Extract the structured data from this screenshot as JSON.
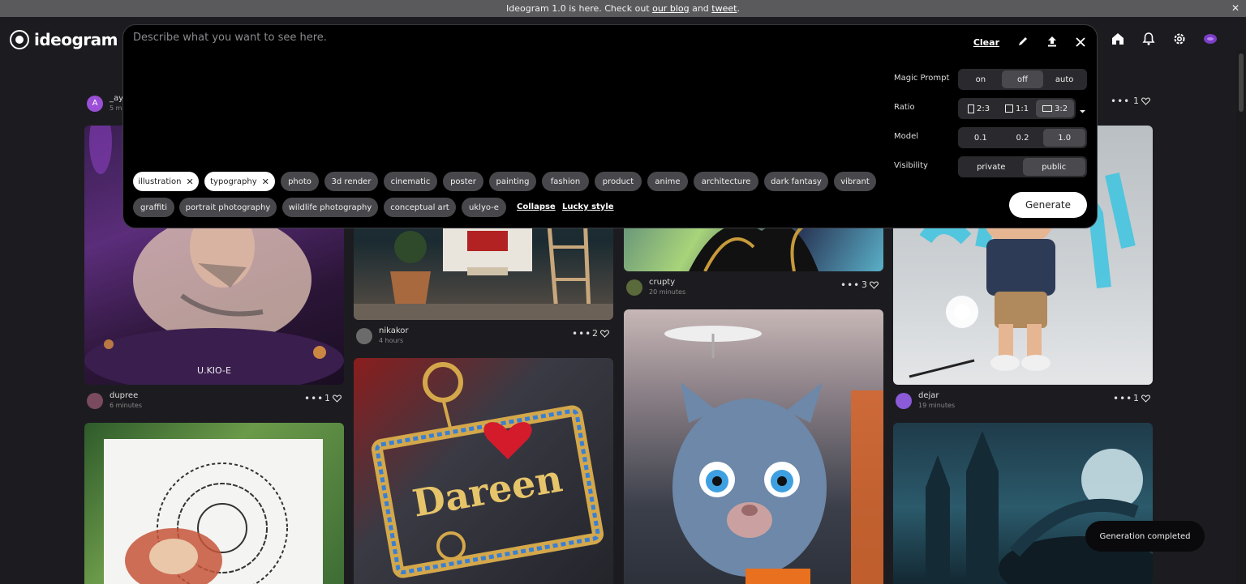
{
  "announcement": {
    "text_before": "Ideogram 1.0 is here. Check out ",
    "blog_link": "our blog",
    "text_mid": " and ",
    "tweet_link": "tweet",
    "text_after": ".",
    "close": "✕"
  },
  "brand": {
    "name": "ideogram"
  },
  "prompt": {
    "placeholder": "Describe what you want to see here.",
    "value": "",
    "clear_label": "Clear"
  },
  "settings": {
    "magic_prompt": {
      "label": "Magic Prompt",
      "options": [
        "on",
        "off",
        "auto"
      ],
      "selected": "off"
    },
    "ratio": {
      "label": "Ratio",
      "options": [
        "2:3",
        "1:1",
        "3:2"
      ],
      "selected": "3:2"
    },
    "model": {
      "label": "Model",
      "options": [
        "0.1",
        "0.2",
        "1.0"
      ],
      "selected": "1.0"
    },
    "visibility": {
      "label": "Visibility",
      "options": [
        "private",
        "public"
      ],
      "selected": "public"
    }
  },
  "style_chips": [
    {
      "label": "illustration",
      "selected": true
    },
    {
      "label": "typography",
      "selected": true
    },
    {
      "label": "photo",
      "selected": false
    },
    {
      "label": "3d render",
      "selected": false
    },
    {
      "label": "cinematic",
      "selected": false
    },
    {
      "label": "poster",
      "selected": false
    },
    {
      "label": "painting",
      "selected": false
    },
    {
      "label": "fashion",
      "selected": false
    },
    {
      "label": "product",
      "selected": false
    },
    {
      "label": "anime",
      "selected": false
    },
    {
      "label": "architecture",
      "selected": false
    },
    {
      "label": "dark fantasy",
      "selected": false
    },
    {
      "label": "vibrant",
      "selected": false
    },
    {
      "label": "graffiti",
      "selected": false
    },
    {
      "label": "portrait photography",
      "selected": false
    },
    {
      "label": "wildlife photography",
      "selected": false
    },
    {
      "label": "conceptual art",
      "selected": false
    },
    {
      "label": "uklyo-e",
      "selected": false
    }
  ],
  "links": {
    "collapse": "Collapse",
    "lucky_style": "Lucky style"
  },
  "generate_label": "Generate",
  "toast": "Generation completed",
  "cards": {
    "top_left": {
      "user": "_ay",
      "time": "5 mi",
      "likes": "1",
      "avatar_letter": "A"
    },
    "dupree": {
      "user": "dupree",
      "time": "6 minutes",
      "likes": "1"
    },
    "nikakor": {
      "user": "nikakor",
      "time": "4 hours",
      "likes": "2"
    },
    "crupty": {
      "user": "crupty",
      "time": "20 minutes",
      "likes": "3"
    },
    "dejar": {
      "user": "dejar",
      "time": "19 minutes",
      "likes": "1"
    },
    "watermark": "U.KIO-E",
    "pendant_text": "Dareen"
  },
  "colors": {
    "accent": "#ffffff",
    "panel_bg": "#000000",
    "page_bg": "#1c1c20",
    "chip_bg": "#48484c",
    "selected_seg": "#4a4a4e"
  }
}
